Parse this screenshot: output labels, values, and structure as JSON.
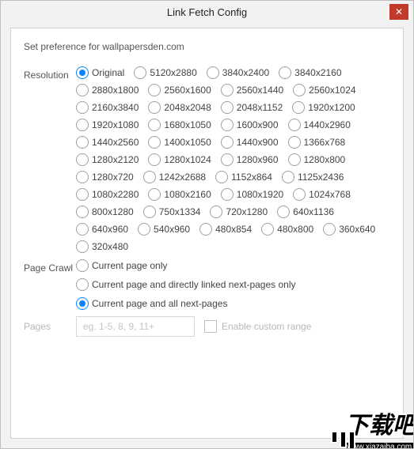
{
  "title": "Link Fetch Config",
  "close_glyph": "✕",
  "preference_text": "Set preference for wallpapersden.com",
  "labels": {
    "resolution": "Resolution",
    "page_crawl": "Page Crawl",
    "pages": "Pages",
    "enable_custom_range": "Enable custom range"
  },
  "resolution": {
    "selected_index": 0,
    "options": [
      "Original",
      "5120x2880",
      "3840x2400",
      "3840x2160",
      "2880x1800",
      "2560x1600",
      "2560x1440",
      "2560x1024",
      "2160x3840",
      "2048x2048",
      "2048x1152",
      "1920x1200",
      "1920x1080",
      "1680x1050",
      "1600x900",
      "1440x2960",
      "1440x2560",
      "1400x1050",
      "1440x900",
      "1366x768",
      "1280x2120",
      "1280x1024",
      "1280x960",
      "1280x800",
      "1280x720",
      "1242x2688",
      "1152x864",
      "1125x2436",
      "1080x2280",
      "1080x2160",
      "1080x1920",
      "1024x768",
      "800x1280",
      "750x1334",
      "720x1280",
      "640x1136",
      "640x960",
      "540x960",
      "480x854",
      "480x800",
      "360x640",
      "320x480"
    ]
  },
  "page_crawl": {
    "selected_index": 2,
    "options": [
      "Current page only",
      "Current page and directly linked next-pages only",
      "Current page and all next-pages"
    ]
  },
  "pages_input": {
    "placeholder": "eg. 1-5, 8, 9, 11+",
    "value": "",
    "enabled": false
  },
  "enable_custom_range_checked": false,
  "watermark": {
    "text": "下载吧",
    "url": "www.xiazaiba.com"
  }
}
